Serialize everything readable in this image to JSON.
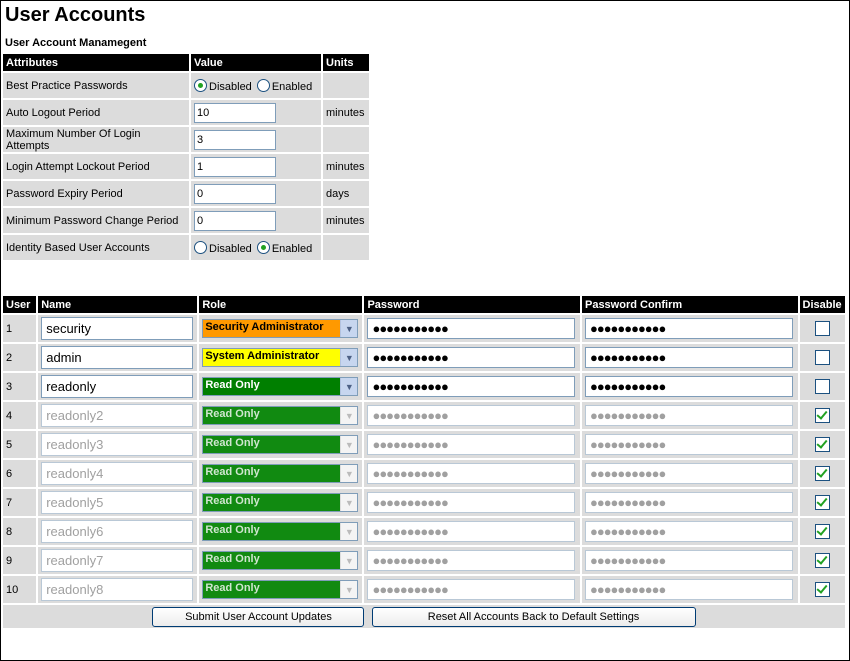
{
  "page": {
    "title": "User Accounts",
    "section": "User Account Manamegent"
  },
  "attributes": {
    "headers": {
      "attribute": "Attributes",
      "value": "Value",
      "units": "Units"
    },
    "best_practice": {
      "label": "Best Practice Passwords",
      "opt1": "Disabled",
      "opt2": "Enabled",
      "selected": "Disabled"
    },
    "auto_logout": {
      "label": "Auto Logout Period",
      "value": "10",
      "units": "minutes"
    },
    "max_attempts": {
      "label": "Maximum Number Of Login Attempts",
      "value": "3",
      "units": ""
    },
    "lockout": {
      "label": "Login Attempt Lockout Period",
      "value": "1",
      "units": "minutes"
    },
    "expiry": {
      "label": "Password Expiry Period",
      "value": "0",
      "units": "days"
    },
    "min_change": {
      "label": "Minimum Password Change Period",
      "value": "0",
      "units": "minutes"
    },
    "identity": {
      "label": "Identity Based User Accounts",
      "opt1": "Disabled",
      "opt2": "Enabled",
      "selected": "Enabled"
    }
  },
  "users": {
    "headers": {
      "user": "User",
      "name": "Name",
      "role": "Role",
      "password": "Password",
      "confirm": "Password Confirm",
      "disable": "Disable"
    },
    "rows": [
      {
        "num": "1",
        "name": "security",
        "role": "Security Administrator",
        "password": "●●●●●●●●●●●",
        "confirm": "●●●●●●●●●●●",
        "disabled": false
      },
      {
        "num": "2",
        "name": "admin",
        "role": "System Administrator",
        "password": "●●●●●●●●●●●",
        "confirm": "●●●●●●●●●●●",
        "disabled": false
      },
      {
        "num": "3",
        "name": "readonly",
        "role": "Read Only",
        "password": "●●●●●●●●●●●",
        "confirm": "●●●●●●●●●●●",
        "disabled": false
      },
      {
        "num": "4",
        "name": "readonly2",
        "role": "Read Only",
        "password": "●●●●●●●●●●●",
        "confirm": "●●●●●●●●●●●",
        "disabled": true
      },
      {
        "num": "5",
        "name": "readonly3",
        "role": "Read Only",
        "password": "●●●●●●●●●●●",
        "confirm": "●●●●●●●●●●●",
        "disabled": true
      },
      {
        "num": "6",
        "name": "readonly4",
        "role": "Read Only",
        "password": "●●●●●●●●●●●",
        "confirm": "●●●●●●●●●●●",
        "disabled": true
      },
      {
        "num": "7",
        "name": "readonly5",
        "role": "Read Only",
        "password": "●●●●●●●●●●●",
        "confirm": "●●●●●●●●●●●",
        "disabled": true
      },
      {
        "num": "8",
        "name": "readonly6",
        "role": "Read Only",
        "password": "●●●●●●●●●●●",
        "confirm": "●●●●●●●●●●●",
        "disabled": true
      },
      {
        "num": "9",
        "name": "readonly7",
        "role": "Read Only",
        "password": "●●●●●●●●●●●",
        "confirm": "●●●●●●●●●●●",
        "disabled": true
      },
      {
        "num": "10",
        "name": "readonly8",
        "role": "Read Only",
        "password": "●●●●●●●●●●●",
        "confirm": "●●●●●●●●●●●",
        "disabled": true
      }
    ],
    "role_colors": {
      "Security Administrator": "#ff9900",
      "System Administrator": "#ffff00",
      "Read Only": "#007f00"
    }
  },
  "buttons": {
    "submit": "Submit User Account Updates",
    "reset": "Reset All Accounts Back to Default Settings"
  }
}
